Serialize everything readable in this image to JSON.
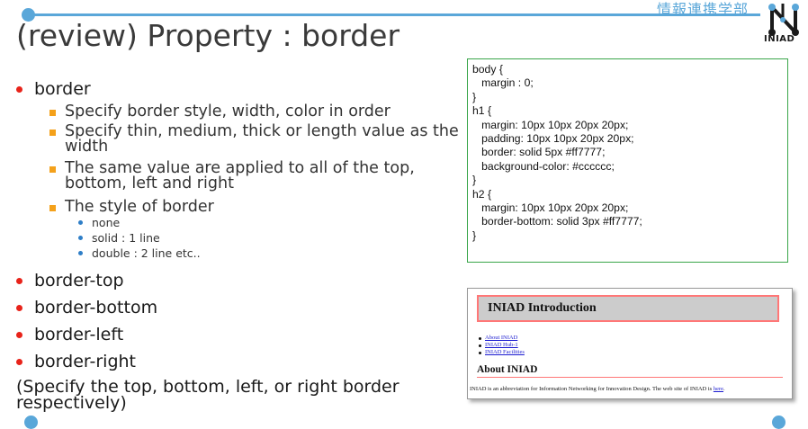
{
  "header": {
    "department": "情報連携学部",
    "logo_text": "INIAD",
    "title": "(review) Property : border"
  },
  "bullets": {
    "border": "border",
    "sub": [
      "Specify border style, width, color in order",
      "Specify thin, medium, thick or length value as the width",
      "The same value are applied to all of the top, bottom, left and right",
      "The style of border"
    ],
    "styles": [
      "none",
      "solid : 1 line",
      "double : 2 line etc.."
    ],
    "border_top": "border-top",
    "border_bottom": "border-bottom",
    "border_left": "border-left",
    "border_right": "border-right",
    "note": "(Specify the top, bottom, left, or right border respectively)"
  },
  "code": {
    "lines": [
      "body {",
      "   margin : 0;",
      "}",
      "h1 {",
      "   margin: 10px 10px 20px 20px;",
      "   padding: 10px 10px 20px 20px;",
      "   border: solid 5px #ff7777;",
      "   background-color: #cccccc;",
      "}",
      "h2 {",
      "   margin: 10px 10px 20px 20px;",
      "   border-bottom: solid 3px #ff7777;",
      "}"
    ]
  },
  "preview": {
    "h1": "INIAD Introduction",
    "links": [
      "About INIAD",
      "INIAD Hub-1",
      "INIAD Facilities"
    ],
    "h2": "About INIAD",
    "paragraph": "INIAD is an abbreviation for Information Networking for Innovation Design. The web site of INIAD is",
    "paragraph_link": "here",
    "paragraph_end": "."
  },
  "colors": {
    "accent_blue": "#5aa7d9",
    "bullet_red": "#e8231a",
    "bullet_orange": "#f4a11b",
    "bullet_blue": "#2e7ec7",
    "code_border": "#3aa64a",
    "border_pink": "#ff7777",
    "h1_background": "#cccccc"
  }
}
